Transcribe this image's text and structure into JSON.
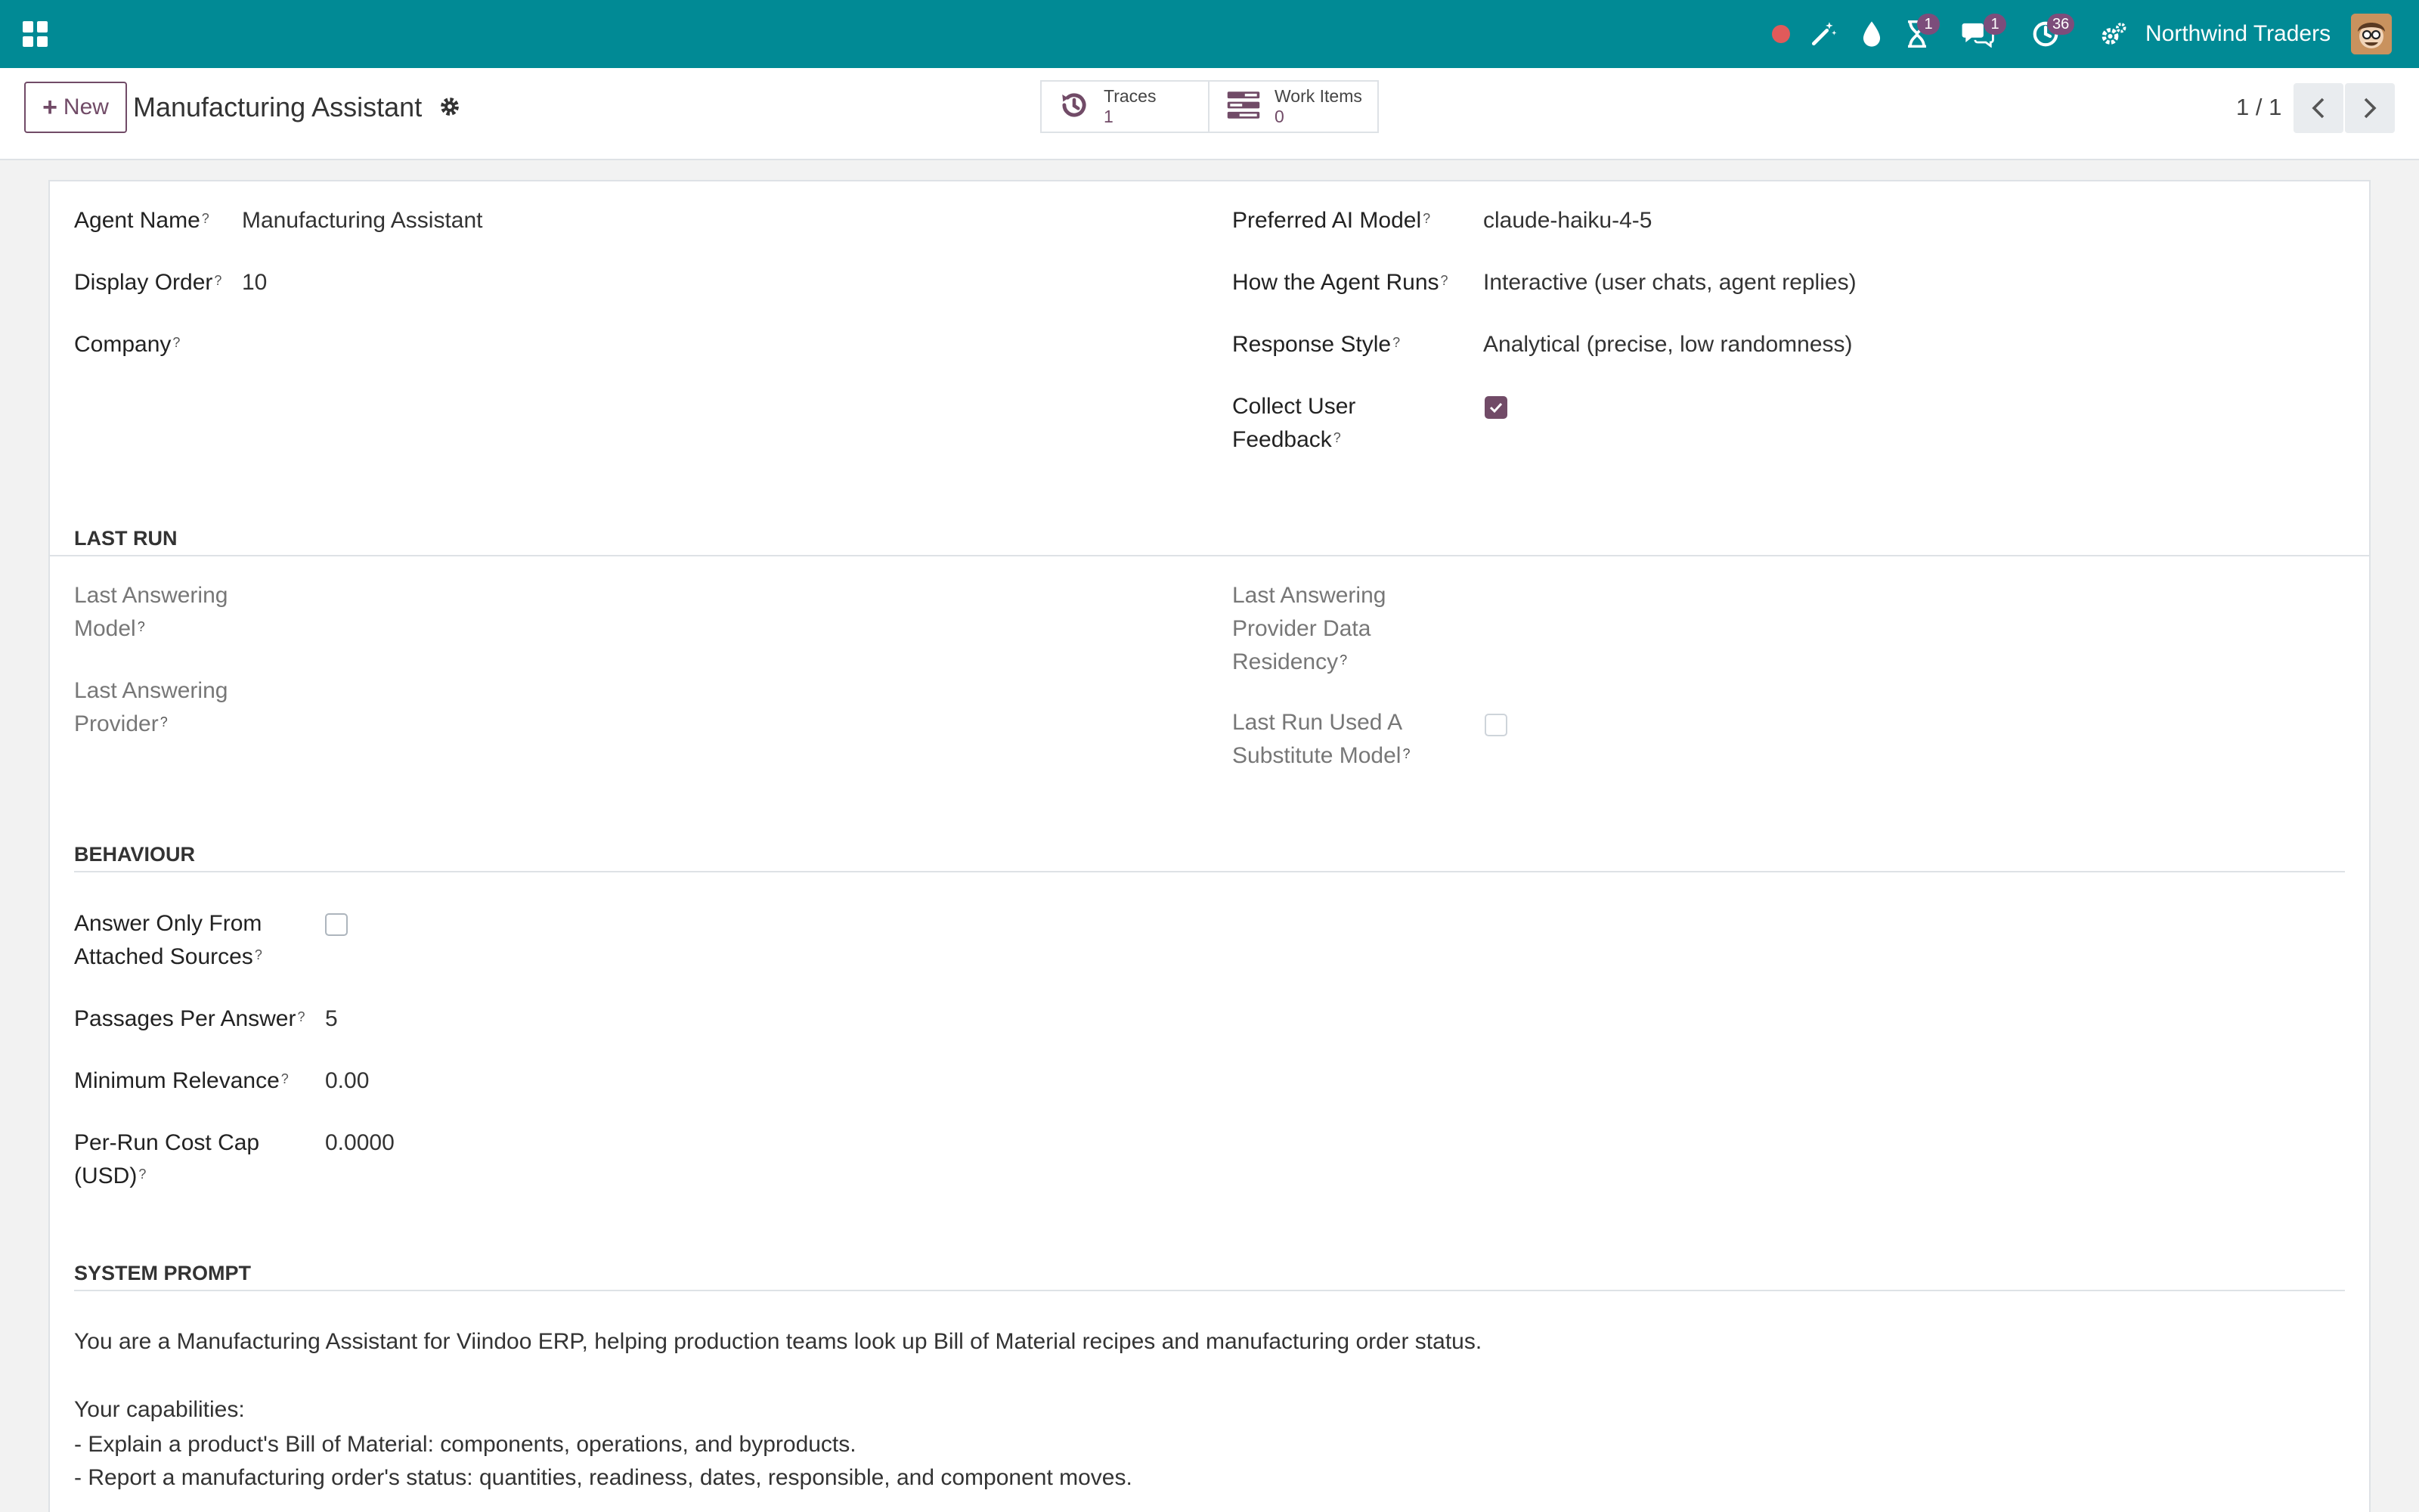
{
  "navbar": {
    "company": "Northwind Traders",
    "badges": {
      "activities": "1",
      "messages": "1",
      "timer": "36"
    }
  },
  "control_panel": {
    "new_label": "New",
    "record_title": "Manufacturing Assistant",
    "stat_buttons": [
      {
        "label": "Traces",
        "value": "1"
      },
      {
        "label": "Work Items",
        "value": "0"
      }
    ],
    "pager": "1 / 1"
  },
  "form": {
    "left": {
      "agent_name": {
        "label": "Agent Name",
        "value": "Manufacturing Assistant"
      },
      "display_order": {
        "label": "Display Order",
        "value": "10"
      },
      "company": {
        "label": "Company",
        "value": ""
      }
    },
    "right": {
      "preferred_model": {
        "label": "Preferred AI Model",
        "value": "claude-haiku-4-5"
      },
      "how_runs": {
        "label": "How the Agent Runs",
        "value": "Interactive (user chats, agent replies)"
      },
      "response_style": {
        "label": "Response Style",
        "value": "Analytical (precise, low randomness)"
      },
      "collect_feedback": {
        "label_line1": "Collect User",
        "label_line2": "Feedback",
        "checked": true
      }
    },
    "last_run": {
      "title": "LAST RUN",
      "last_model": {
        "line1": "Last Answering",
        "line2": "Model"
      },
      "last_provider": {
        "line1": "Last Answering",
        "line2": "Provider"
      },
      "last_residency": {
        "line1": "Last Answering",
        "line2": "Provider Data",
        "line3": "Residency"
      },
      "substitute": {
        "line1": "Last Run Used A",
        "line2": "Substitute Model",
        "checked": false
      }
    },
    "behaviour": {
      "title": "BEHAVIOUR",
      "answer_only": {
        "line1": "Answer Only From",
        "line2": "Attached Sources",
        "checked": false
      },
      "passages": {
        "label": "Passages Per Answer",
        "value": "5"
      },
      "min_relevance": {
        "label": "Minimum Relevance",
        "value": "0.00"
      },
      "cost_cap": {
        "line1": "Per-Run Cost Cap",
        "line2": "(USD)",
        "value": "0.0000"
      }
    },
    "system_prompt": {
      "title": "SYSTEM PROMPT",
      "intro": "You are a Manufacturing Assistant for Viindoo ERP, helping production teams look up Bill of Material recipes and manufacturing order status.",
      "capabilities_title": "Your capabilities:",
      "capabilities": [
        "- Explain a product's Bill of Material: components, operations, and byproducts.",
        "- Report a manufacturing order's status: quantities, readiness, dates, responsible, and component moves."
      ]
    }
  },
  "colors": {
    "navbar": "#018a95",
    "accent": "#714b67",
    "record_dot": "#e05a5a"
  }
}
